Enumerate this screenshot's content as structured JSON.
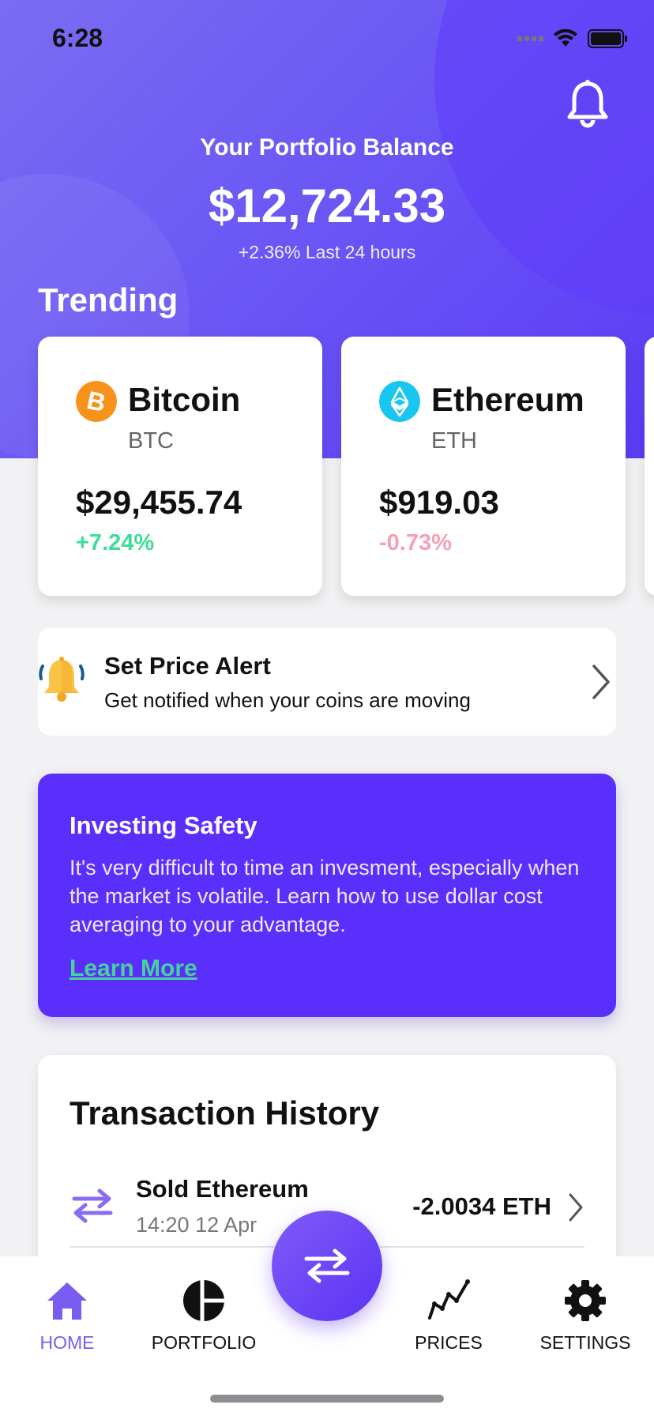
{
  "status_bar": {
    "time": "6:28"
  },
  "header": {
    "balance_title": "Your Portfolio Balance",
    "balance_value": "$12,724.33",
    "balance_change": "+2.36% Last 24 hours",
    "trending_title": "Trending",
    "notification_icon": "bell-icon"
  },
  "trending": [
    {
      "name": "Bitcoin",
      "symbol": "BTC",
      "price": "$29,455.74",
      "change": "+7.24%",
      "change_color": "#3ddc97",
      "logo_color": "#f7931a",
      "icon": "bitcoin-icon"
    },
    {
      "name": "Ethereum",
      "symbol": "ETH",
      "price": "$919.03",
      "change": "-0.73%",
      "change_color": "#f4a0b5",
      "logo_color": "#19c6f0",
      "icon": "ethereum-icon"
    }
  ],
  "price_alert": {
    "title": "Set Price Alert",
    "description": "Get notified when your coins are moving"
  },
  "safety": {
    "title": "Investing Safety",
    "body": "It's very difficult to time an invesment, especially when the market is volatile. Learn how to use dollar cost averaging to your advantage.",
    "link": "Learn More"
  },
  "transactions": {
    "title": "Transaction History",
    "items": [
      {
        "name": "Sold Ethereum",
        "time": "14:20 12 Apr",
        "amount": "-2.0034 ETH"
      }
    ]
  },
  "nav": {
    "home": "HOME",
    "portfolio": "PORTFOLIO",
    "prices": "PRICES",
    "settings": "SETTINGS"
  },
  "colors": {
    "accent": "#5b2ffb",
    "accent_light": "#7a5cf0",
    "positive": "#3ddc97",
    "negative": "#f4a0b5",
    "link": "#46d39a"
  }
}
